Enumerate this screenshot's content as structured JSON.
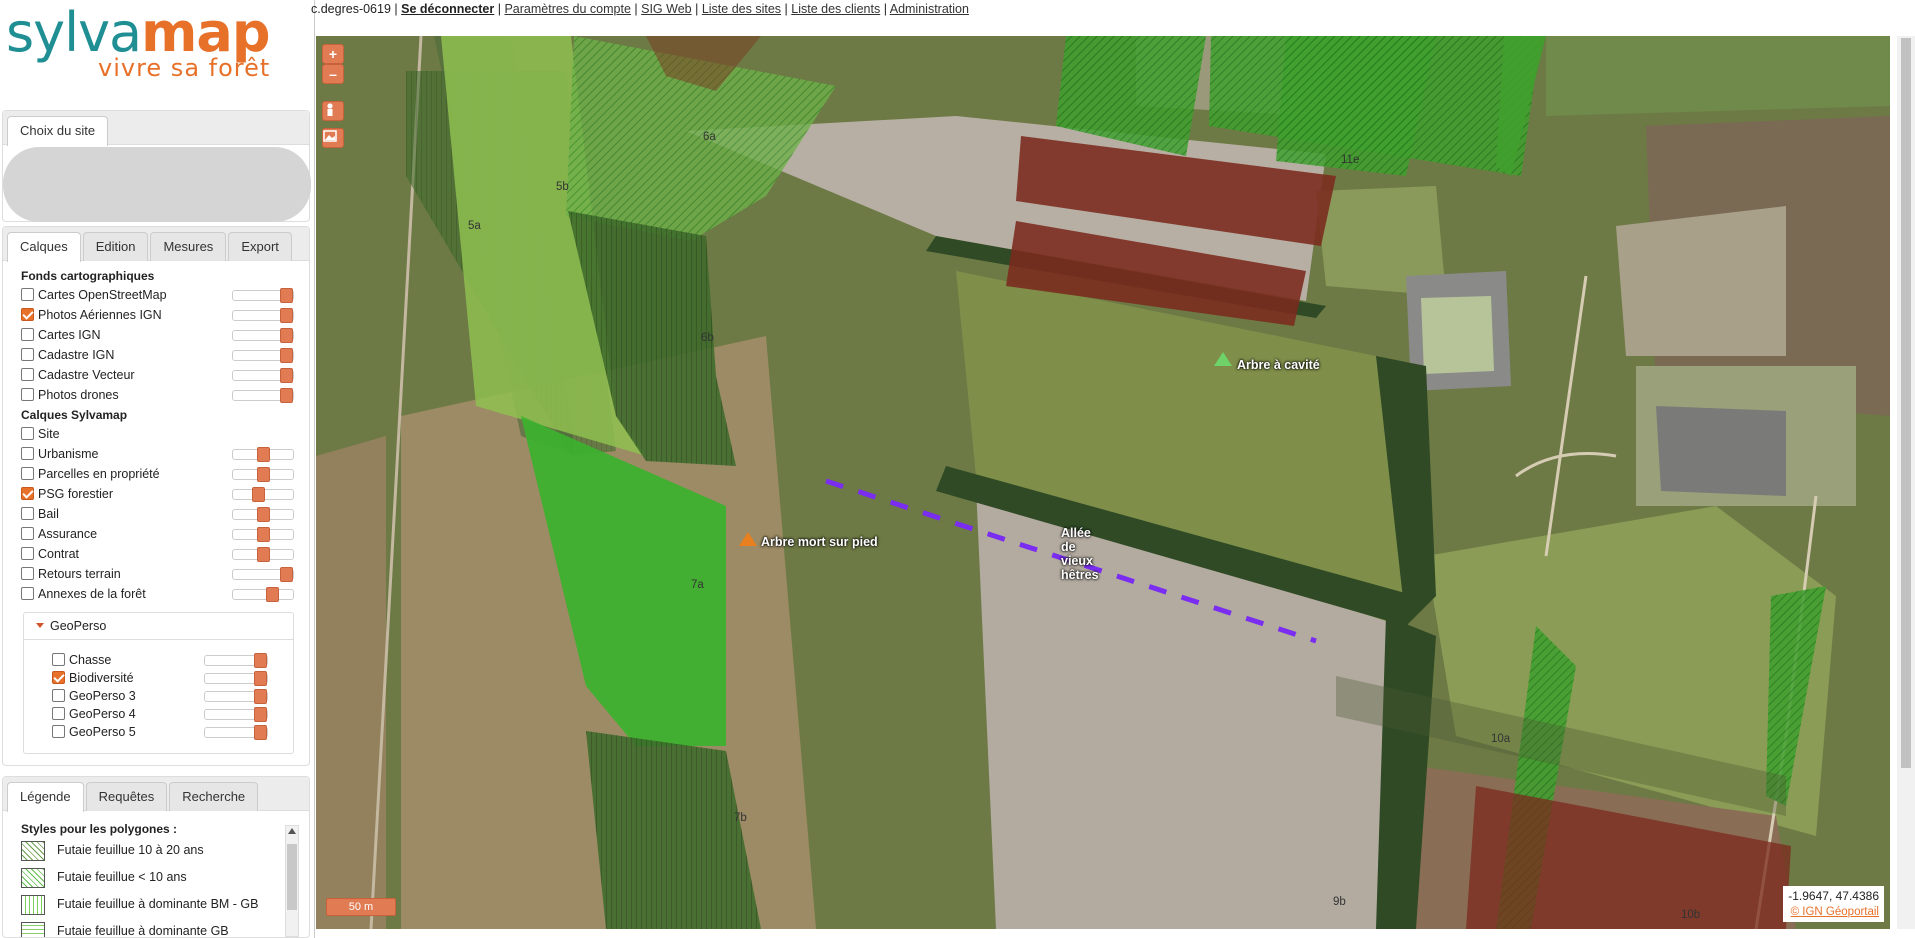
{
  "logo": {
    "word_a": "sylva",
    "word_b": "map",
    "tagline": "vivre sa forêt"
  },
  "topnav": {
    "user": "c.degres-0619",
    "sep": "|",
    "logout": "Se déconnecter",
    "items": [
      "Paramètres du compte",
      "SIG Web",
      "Liste des sites",
      "Liste des clients",
      "Administration"
    ]
  },
  "site_panel": {
    "tab": "Choix du site"
  },
  "layers_panel": {
    "tabs": [
      "Calques",
      "Edition",
      "Mesures",
      "Export"
    ],
    "section_fonds": "Fonds cartographiques",
    "fonds": [
      {
        "label": "Cartes OpenStreetMap",
        "checked": false,
        "opacity": 1.0
      },
      {
        "label": "Photos Aériennes IGN",
        "checked": true,
        "opacity": 1.0
      },
      {
        "label": "Cartes IGN",
        "checked": false,
        "opacity": 1.0
      },
      {
        "label": "Cadastre IGN",
        "checked": false,
        "opacity": 1.0
      },
      {
        "label": "Cadastre Vecteur",
        "checked": false,
        "opacity": 1.0
      },
      {
        "label": "Photos drones",
        "checked": false,
        "opacity": 1.0
      }
    ],
    "section_calques": "Calques Sylvamap",
    "calques": [
      {
        "label": "Site",
        "checked": false,
        "opacity": null
      },
      {
        "label": "Urbanisme",
        "checked": false,
        "opacity": 0.5
      },
      {
        "label": "Parcelles en propriété",
        "checked": false,
        "opacity": 0.5
      },
      {
        "label": "PSG forestier",
        "checked": true,
        "opacity": 0.4
      },
      {
        "label": "Bail",
        "checked": false,
        "opacity": 0.5
      },
      {
        "label": "Assurance",
        "checked": false,
        "opacity": 0.5
      },
      {
        "label": "Contrat",
        "checked": false,
        "opacity": 0.5
      },
      {
        "label": "Retours terrain",
        "checked": false,
        "opacity": 1.0
      },
      {
        "label": "Annexes de la forêt",
        "checked": false,
        "opacity": 0.7
      }
    ],
    "geoperso": {
      "title": "GeoPerso",
      "items": [
        {
          "label": "Chasse",
          "checked": false,
          "opacity": 1.0
        },
        {
          "label": "Biodiversité",
          "checked": true,
          "opacity": 1.0
        },
        {
          "label": "GeoPerso 3",
          "checked": false,
          "opacity": 1.0
        },
        {
          "label": "GeoPerso 4",
          "checked": false,
          "opacity": 1.0
        },
        {
          "label": "GeoPerso 5",
          "checked": false,
          "opacity": 1.0
        }
      ]
    }
  },
  "legend_panel": {
    "tabs": [
      "Légende",
      "Requêtes",
      "Recherche"
    ],
    "title": "Styles pour les polygones :",
    "items": [
      {
        "label": "Futaie feuillue 10 à 20 ans",
        "swatch": "sw1"
      },
      {
        "label": "Futaie feuillue < 10 ans",
        "swatch": "sw2"
      },
      {
        "label": "Futaie feuillue à dominante BM - GB",
        "swatch": "sw3"
      },
      {
        "label": "Futaie feuillue à dominante GB",
        "swatch": "sw4"
      }
    ]
  },
  "map": {
    "zoom_in": "+",
    "zoom_out": "–",
    "scale": "50 m",
    "coords": "-1.9647, 47.4386",
    "attribution": "© IGN Géoportail",
    "parcels": [
      "5a",
      "5b",
      "6a",
      "6b",
      "7a",
      "7b",
      "9b",
      "10a",
      "10b",
      "11e"
    ],
    "points": [
      {
        "label": "Arbre à cavité",
        "color": "#6fd36a"
      },
      {
        "label": "Arbre mort sur pied",
        "color": "#e8801f"
      }
    ],
    "line_label": [
      "Allée",
      "de",
      "vieux",
      "hêtres"
    ],
    "line_color": "#7a2cf0"
  }
}
